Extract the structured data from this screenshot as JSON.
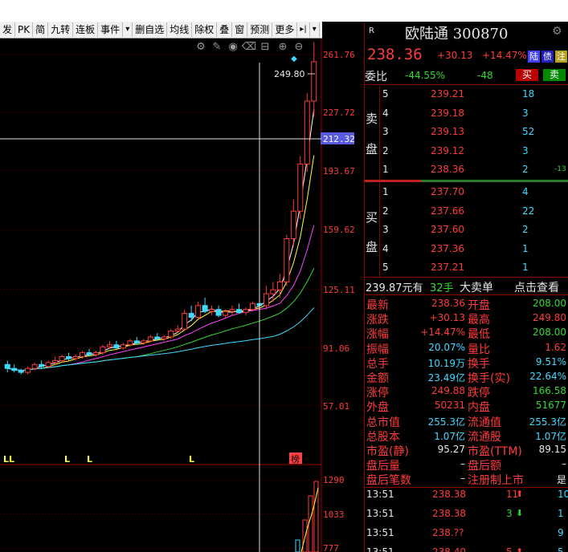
{
  "toolbar": {
    "items": [
      "发",
      "PK",
      "简",
      "九转",
      "连板",
      "事件",
      "▾",
      "删自选",
      "均线",
      "除权",
      "叠",
      "窗",
      "预测",
      "更多",
      "▸|",
      "▾"
    ]
  },
  "chart": {
    "price_ticks": [
      "261.76",
      "227.72",
      "212.32",
      "193.67",
      "159.62",
      "125.11",
      "91.06",
      "57.01"
    ],
    "crosshair_value": "212.32",
    "high_label": "249.80",
    "volume_ticks": [
      "1290",
      "1033",
      "777"
    ],
    "markers": [
      "LL",
      "L",
      "L",
      "L",
      "榜"
    ],
    "tool_icons": [
      "gear-icon",
      "pen-icon",
      "eye-icon",
      "trash-icon",
      "lock-icon",
      "zoom-in-icon",
      "zoom-out-icon"
    ],
    "candles": [
      [
        0.13,
        0.14,
        0.11,
        0.12
      ],
      [
        0.12,
        0.13,
        0.11,
        0.115
      ],
      [
        0.115,
        0.12,
        0.105,
        0.11
      ],
      [
        0.11,
        0.125,
        0.105,
        0.12
      ],
      [
        0.12,
        0.135,
        0.115,
        0.13
      ],
      [
        0.13,
        0.14,
        0.12,
        0.125
      ],
      [
        0.125,
        0.14,
        0.12,
        0.135
      ],
      [
        0.135,
        0.15,
        0.13,
        0.14
      ],
      [
        0.14,
        0.155,
        0.135,
        0.15
      ],
      [
        0.15,
        0.16,
        0.14,
        0.145
      ],
      [
        0.145,
        0.155,
        0.14,
        0.15
      ],
      [
        0.15,
        0.165,
        0.145,
        0.16
      ],
      [
        0.16,
        0.17,
        0.15,
        0.155
      ],
      [
        0.155,
        0.165,
        0.15,
        0.16
      ],
      [
        0.16,
        0.18,
        0.155,
        0.175
      ],
      [
        0.175,
        0.19,
        0.17,
        0.18
      ],
      [
        0.18,
        0.19,
        0.17,
        0.172
      ],
      [
        0.172,
        0.185,
        0.168,
        0.18
      ],
      [
        0.18,
        0.195,
        0.175,
        0.19
      ],
      [
        0.19,
        0.2,
        0.18,
        0.185
      ],
      [
        0.185,
        0.195,
        0.18,
        0.19
      ],
      [
        0.19,
        0.205,
        0.185,
        0.2
      ],
      [
        0.2,
        0.21,
        0.19,
        0.195
      ],
      [
        0.195,
        0.205,
        0.19,
        0.2
      ],
      [
        0.2,
        0.22,
        0.195,
        0.215
      ],
      [
        0.215,
        0.23,
        0.21,
        0.22
      ],
      [
        0.22,
        0.27,
        0.215,
        0.26
      ],
      [
        0.26,
        0.28,
        0.24,
        0.25
      ],
      [
        0.25,
        0.29,
        0.245,
        0.28
      ],
      [
        0.28,
        0.3,
        0.26,
        0.265
      ],
      [
        0.265,
        0.28,
        0.255,
        0.27
      ],
      [
        0.27,
        0.28,
        0.25,
        0.255
      ],
      [
        0.255,
        0.27,
        0.25,
        0.265
      ],
      [
        0.265,
        0.28,
        0.255,
        0.27
      ],
      [
        0.27,
        0.285,
        0.26,
        0.262
      ],
      [
        0.262,
        0.275,
        0.255,
        0.27
      ],
      [
        0.27,
        0.29,
        0.265,
        0.285
      ],
      [
        0.285,
        0.3,
        0.275,
        0.28
      ],
      [
        0.28,
        0.33,
        0.27,
        0.31
      ],
      [
        0.31,
        0.34,
        0.29,
        0.32
      ],
      [
        0.32,
        0.36,
        0.3,
        0.34
      ],
      [
        0.34,
        0.46,
        0.33,
        0.45
      ],
      [
        0.45,
        0.55,
        0.43,
        0.52
      ],
      [
        0.52,
        0.66,
        0.5,
        0.64
      ],
      [
        0.64,
        0.82,
        0.62,
        0.8
      ],
      [
        0.8,
        0.95,
        0.76,
        0.9
      ]
    ]
  },
  "panel": {
    "title": "欧陆通 300870",
    "r_label": "R",
    "price": "238.36",
    "change": "+30.13",
    "pct": "+14.47%",
    "tags": [
      "陆",
      "债",
      "注"
    ],
    "weibi_label": "委比",
    "weibi_pct": "-44.55%",
    "weibi_diff": "-48",
    "buy_btn": "买",
    "sell_btn": "卖",
    "sell_side_label": [
      "卖",
      "盘"
    ],
    "buy_side_label": [
      "买",
      "盘"
    ],
    "asks": [
      {
        "lvl": "5",
        "price": "239.21",
        "vol": "18",
        "chg": ""
      },
      {
        "lvl": "4",
        "price": "239.18",
        "vol": "3",
        "chg": ""
      },
      {
        "lvl": "3",
        "price": "239.13",
        "vol": "52",
        "chg": ""
      },
      {
        "lvl": "2",
        "price": "239.12",
        "vol": "3",
        "chg": ""
      },
      {
        "lvl": "1",
        "price": "238.36",
        "vol": "2",
        "chg": "-13"
      }
    ],
    "bids": [
      {
        "lvl": "1",
        "price": "237.70",
        "vol": "4"
      },
      {
        "lvl": "2",
        "price": "237.66",
        "vol": "22"
      },
      {
        "lvl": "3",
        "price": "237.60",
        "vol": "2"
      },
      {
        "lvl": "4",
        "price": "237.36",
        "vol": "1"
      },
      {
        "lvl": "5",
        "price": "237.21",
        "vol": "1"
      }
    ],
    "bigorder": {
      "price": "239.87元有",
      "qty": "32手",
      "label": "大卖单",
      "link": "点击查看"
    },
    "stats": [
      {
        "l1": "最新",
        "v1": "238.36",
        "c1": "red",
        "l2": "开盘",
        "v2": "208.00",
        "c2": "grn"
      },
      {
        "l1": "涨跌",
        "v1": "+30.13",
        "c1": "red",
        "l2": "最高",
        "v2": "249.80",
        "c2": "red"
      },
      {
        "l1": "涨幅",
        "v1": "+14.47%",
        "c1": "red",
        "l2": "最低",
        "v2": "208.00",
        "c2": "grn"
      },
      {
        "l1": "振幅",
        "v1": "20.07%",
        "c1": "cyn",
        "l2": "量比",
        "v2": "1.62",
        "c2": "red"
      },
      {
        "l1": "总手",
        "v1": "10.19万",
        "c1": "cyn",
        "l2": "换手",
        "v2": "9.51%",
        "c2": "cyn"
      },
      {
        "l1": "金额",
        "v1": "23.49亿",
        "c1": "cyn",
        "l2": "换手(实)",
        "v2": "22.64%",
        "c2": "cyn"
      },
      {
        "l1": "涨停",
        "v1": "249.88",
        "c1": "red",
        "l2": "跌停",
        "v2": "166.58",
        "c2": "grn"
      },
      {
        "l1": "外盘",
        "v1": "50231",
        "c1": "red",
        "l2": "内盘",
        "v2": "51677",
        "c2": "grn"
      },
      {
        "l1": "总市值",
        "v1": "255.3亿",
        "c1": "cyn",
        "l2": "流通值",
        "v2": "255.3亿",
        "c2": "cyn"
      },
      {
        "l1": "总股本",
        "v1": "1.07亿",
        "c1": "cyn",
        "l2": "流通股",
        "v2": "1.07亿",
        "c2": "cyn"
      },
      {
        "l1": "市盈(静)",
        "v1": "95.27",
        "c1": "wht",
        "l2": "市盈(TTM)",
        "v2": "89.15",
        "c2": "wht"
      },
      {
        "l1": "盘后量",
        "v1": "–",
        "c1": "wht",
        "l2": "盘后额",
        "v2": "–",
        "c2": "wht"
      },
      {
        "l1": "盘后笔数",
        "v1": "–",
        "c1": "wht",
        "l2": "注册制上市",
        "v2": "是",
        "c2": "wht"
      }
    ],
    "ticks": [
      {
        "time": "13:51",
        "price": "238.38",
        "vol": "11",
        "dir": "up",
        "n": "10"
      },
      {
        "time": "13:51",
        "price": "238.38",
        "vol": "3",
        "dir": "down",
        "n": "1"
      },
      {
        "time": "13:51",
        "price": "238.??",
        "vol": "",
        "dir": "",
        "n": "9"
      },
      {
        "time": "13:51",
        "price": "238.40",
        "vol": "5",
        "dir": "up",
        "n": "5"
      }
    ]
  },
  "colors": {
    "up": "#ff3b3b",
    "down": "#32d932",
    "accent": "#3fd9ff",
    "bg": "#000000"
  }
}
